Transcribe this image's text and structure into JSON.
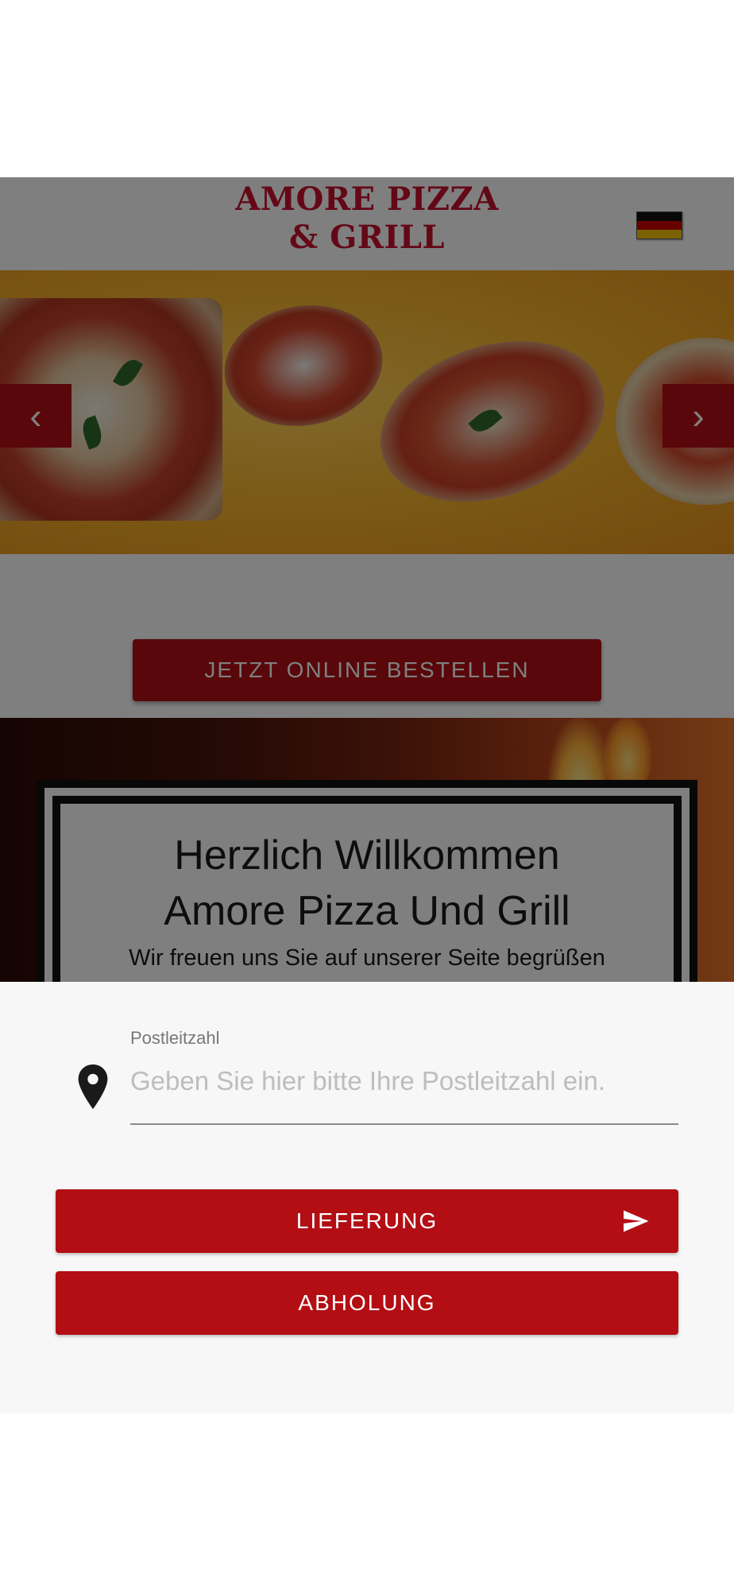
{
  "header": {
    "logo_line1": "AMORE PIZZA",
    "logo_line2": "& GRILL",
    "language_flag": "germany-flag-icon"
  },
  "slider": {
    "prev_icon": "chevron-left-icon",
    "next_icon": "chevron-right-icon",
    "prev_glyph": "‹",
    "next_glyph": "›"
  },
  "order": {
    "button_label": "JETZT ONLINE BESTELLEN"
  },
  "welcome": {
    "title_line1": "Herzlich Willkommen",
    "title_line2": "Amore Pizza Und Grill",
    "subtitle": "Wir freuen uns Sie auf unserer Seite begrüßen"
  },
  "sheet": {
    "postal_label": "Postleitzahl",
    "postal_placeholder": "Geben Sie hier bitte Ihre Postleitzahl ein.",
    "postal_value": "",
    "delivery_label": "LIEFERUNG",
    "pickup_label": "ABHOLUNG"
  },
  "colors": {
    "brand_red": "#b30e14",
    "logo_red": "#c8102e",
    "sheet_bg": "#f7f7f7"
  }
}
